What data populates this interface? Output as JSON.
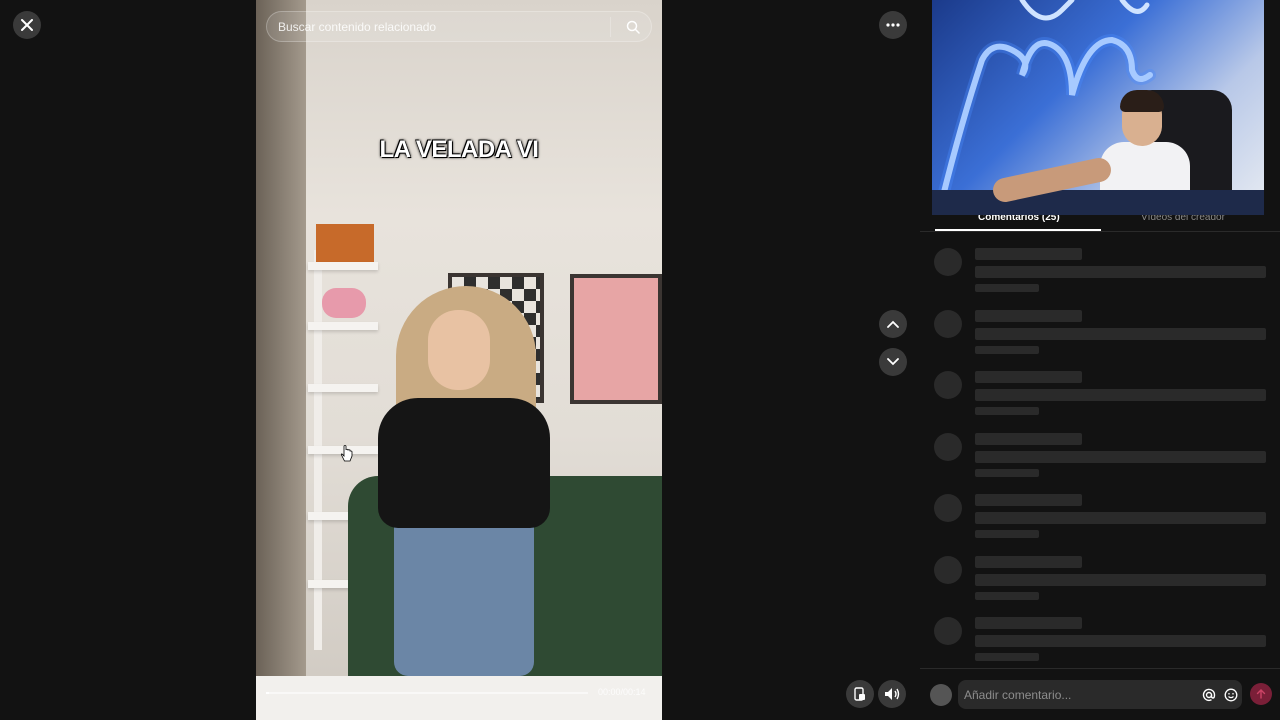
{
  "search": {
    "placeholder": "Buscar contenido relacionado"
  },
  "video": {
    "overlay_title": "LA VELADA VI",
    "time": "00:00/00:14",
    "progress": 0.01
  },
  "comments": {
    "tab_comments": "Comentarios (25)",
    "tab_creator": "Vídeos del creador"
  },
  "comment_bar": {
    "placeholder": "Añadir comentario..."
  },
  "colors": {
    "background": "#121212",
    "skeleton": "#2a2a2a",
    "send": "#7a1f38"
  },
  "icons": [
    "close-icon",
    "search-icon",
    "more-icon",
    "chevron-up-icon",
    "chevron-down-icon",
    "picture-in-picture-icon",
    "volume-icon",
    "at-icon",
    "emoji-icon",
    "send-icon"
  ]
}
